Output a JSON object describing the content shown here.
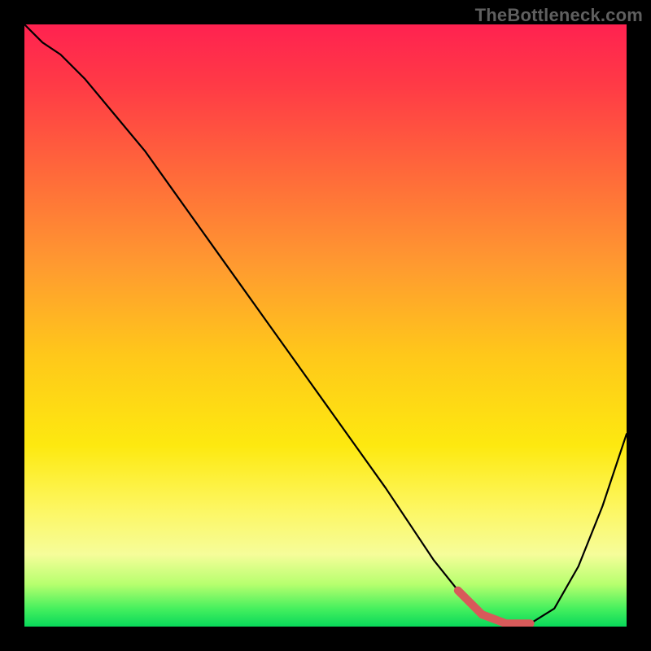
{
  "watermark": "TheBottleneck.com",
  "chart_data": {
    "type": "line",
    "title": "",
    "xlabel": "",
    "ylabel": "",
    "xlim": [
      0,
      100
    ],
    "ylim": [
      0,
      100
    ],
    "grid": false,
    "legend": false,
    "series": [
      {
        "name": "bottleneck-curve",
        "x": [
          0,
          3,
          6,
          10,
          15,
          20,
          25,
          30,
          35,
          40,
          45,
          50,
          55,
          60,
          64,
          68,
          72,
          76,
          80,
          84,
          88,
          92,
          96,
          100
        ],
        "values": [
          100,
          97,
          95,
          91,
          85,
          79,
          72,
          65,
          58,
          51,
          44,
          37,
          30,
          23,
          17,
          11,
          6,
          2,
          0.5,
          0.5,
          3,
          10,
          20,
          32
        ]
      }
    ],
    "highlight": {
      "x_start": 70,
      "x_end": 85,
      "description": "flat-minimum-segment"
    },
    "background_gradient": {
      "top": "#ff2250",
      "mid": "#fde910",
      "bottom": "#08d85a"
    }
  }
}
